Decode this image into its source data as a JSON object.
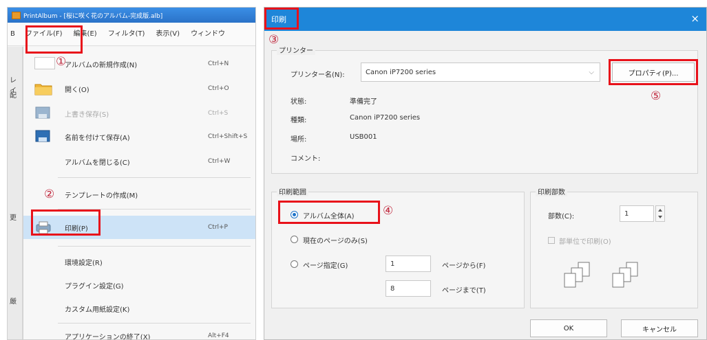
{
  "left": {
    "window_title": "PrintAlbum - [桜に咲く花のアルバム-完成版.alb]",
    "menubar": {
      "edge": "B",
      "items": [
        "ファイル(F)",
        "編集(E)",
        "フィルタ(T)",
        "表示(V)",
        "ウィンドウ"
      ]
    },
    "side_strip": [
      "レイ",
      "配",
      "更",
      "厳"
    ],
    "file_menu": [
      {
        "label": "アルバムの新規作成(N)",
        "shortcut": "Ctrl+N",
        "icon": "new-album-icon",
        "disabled": false
      },
      {
        "label": "開く(O)",
        "shortcut": "Ctrl+O",
        "icon": "folder-icon",
        "disabled": false
      },
      {
        "label": "上書き保存(S)",
        "shortcut": "Ctrl+S",
        "icon": "save-icon",
        "disabled": true
      },
      {
        "label": "名前を付けて保存(A)",
        "shortcut": "Ctrl+Shift+S",
        "icon": "save-as-icon",
        "disabled": false
      },
      {
        "label": "アルバムを閉じる(C)",
        "shortcut": "Ctrl+W",
        "icon": "",
        "disabled": false
      },
      {
        "label": "テンプレートの作成(M)",
        "shortcut": "",
        "icon": "",
        "disabled": false
      },
      {
        "label": "印刷(P)",
        "shortcut": "Ctrl+P",
        "icon": "print-icon",
        "disabled": false
      },
      {
        "label": "環境設定(R)",
        "shortcut": "",
        "icon": "",
        "disabled": false
      },
      {
        "label": "プラグイン設定(G)",
        "shortcut": "",
        "icon": "",
        "disabled": false
      },
      {
        "label": "カスタム用紙設定(K)",
        "shortcut": "",
        "icon": "",
        "disabled": false
      },
      {
        "label": "アプリケーションの終了(X)",
        "shortcut": "Alt+F4",
        "icon": "",
        "disabled": false
      }
    ]
  },
  "dialog": {
    "title": "印刷",
    "close_glyph": "×",
    "printer_group_label": "プリンター",
    "printer_name_label": "プリンター名(N):",
    "printer_name_value": "Canon iP7200 series",
    "dropdown_glyph": "⌵",
    "properties_button": "プロパティ(P)...",
    "status_label": "状態:",
    "status_value": "準備完了",
    "type_label": "種類:",
    "type_value": "Canon iP7200 series",
    "location_label": "場所:",
    "location_value": "USB001",
    "comment_label": "コメント:",
    "range_group_label": "印刷範囲",
    "range_all": "アルバム全体(A)",
    "range_current": "現在のページのみ(S)",
    "range_pages": "ページ指定(G)",
    "page_from_value": "1",
    "page_from_label": "ページから(F)",
    "page_to_value": "8",
    "page_to_label": "ページまで(T)",
    "copies_group_label": "印刷部数",
    "copies_label": "部数(C):",
    "copies_value": "1",
    "collate_label": "部単位で印刷(O)",
    "ok_button": "OK",
    "cancel_button": "キャンセル"
  },
  "annotations": [
    "①",
    "②",
    "③",
    "④",
    "⑤"
  ],
  "colors": {
    "highlight_red": "#e8111a",
    "number_color": "#c0283d",
    "title_blue": "#1e86d9"
  }
}
